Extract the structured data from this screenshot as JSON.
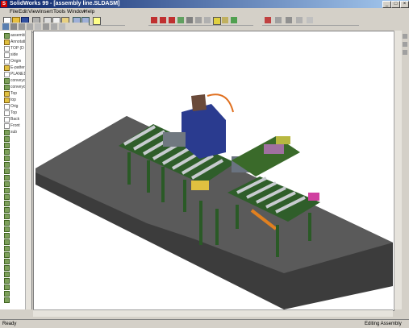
{
  "window": {
    "title": "SolidWorks 99 - [assembly line.SLDASM]"
  },
  "menu": [
    "File",
    "Edit",
    "View",
    "Insert",
    "Tools",
    "Window",
    "Help"
  ],
  "tree": {
    "items": [
      "assembly li",
      "Annotati",
      "TOP (D",
      "side",
      "Origin",
      "E-pattern",
      "PLANE1",
      "conveyor",
      "conveyor",
      "Top",
      "top",
      "Orig",
      "Top",
      "Back",
      "Front",
      "sub"
    ]
  },
  "status": {
    "left": "Ready",
    "right": "Editing Assembly"
  },
  "icons": {
    "toolbar_1": [
      "new-icon",
      "open-icon",
      "save-icon",
      "print-icon",
      "cut-icon",
      "copy-icon",
      "paste-icon",
      "undo-icon",
      "redo-icon",
      "help-icon"
    ],
    "toolbar_2": [
      "zoom-fit-icon",
      "zoom-area-icon",
      "zoom-in-icon",
      "pan-icon",
      "rotate-icon",
      "view-orient-icon",
      "section-icon",
      "wireframe-icon",
      "hidden-lines-icon",
      "shaded-icon"
    ],
    "toolbar_3": [
      "mate-icon",
      "move-icon",
      "rotate-component-icon",
      "explode-icon",
      "interference-icon"
    ]
  },
  "colors": {
    "accent": "#0a246a",
    "frame": "#3a6a2a",
    "rollers": "#c8ccd0",
    "base": "#505050",
    "press": "#2a3b8f"
  }
}
